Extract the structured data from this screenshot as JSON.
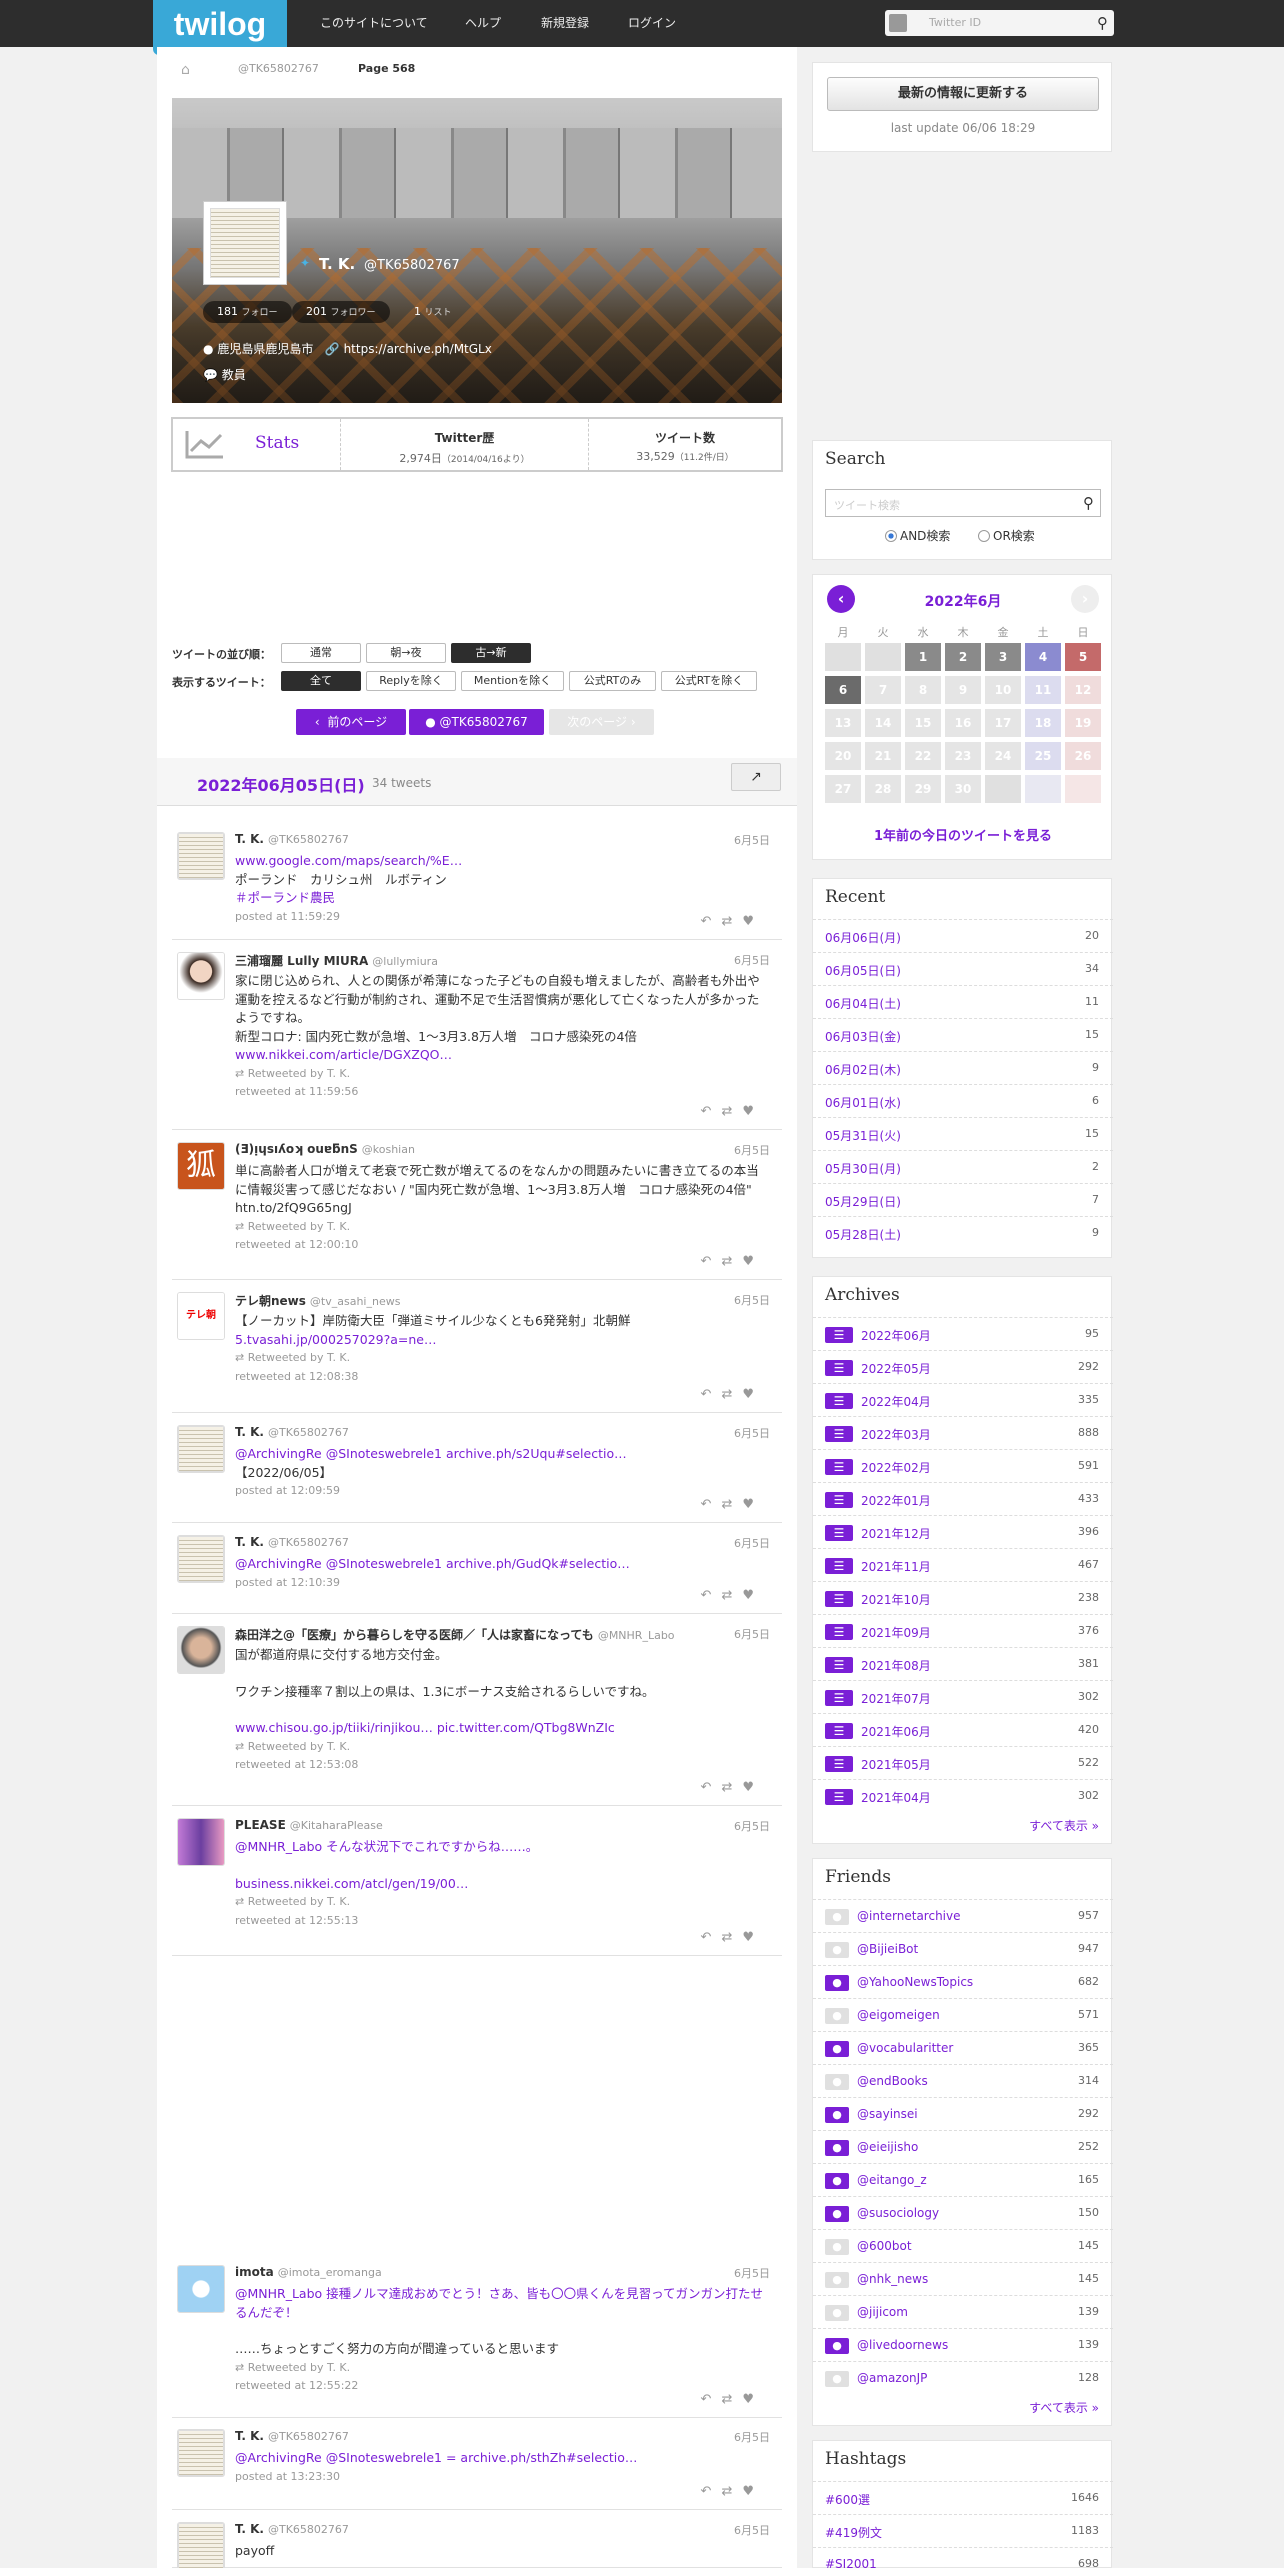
{
  "header": {
    "logo": "twilog",
    "nav": [
      "このサイトについて",
      "ヘルプ",
      "新規登録",
      "ログイン"
    ],
    "search_placeholder": "Twitter ID"
  },
  "breadcrumb": {
    "user": "@TK65802767",
    "page": "Page 568"
  },
  "profile": {
    "name": "T. K.",
    "handle": "@TK65802767",
    "follow_count": "181",
    "follow_label": "フォロー",
    "follower_count": "201",
    "follower_label": "フォロワー",
    "list_count": "1",
    "list_label": "リスト",
    "location": "鹿児島県鹿児島市",
    "url": "https://archive.ph/MtGLx",
    "job": "教員"
  },
  "stats": {
    "label": "Stats",
    "history_title": "Twitter歴",
    "history_value": "2,974日",
    "history_sub": "（2014/04/16より）",
    "tweets_title": "ツイート数",
    "tweets_value": "33,529",
    "tweets_sub": "（11.2件/日）"
  },
  "options": {
    "order_label": "ツイートの並び順：",
    "order": [
      "通常",
      "朝→夜",
      "古→新"
    ],
    "show_label": "表示するツイート：",
    "show": [
      "全て",
      "Replyを除く",
      "Mentionを除く",
      "公式RTのみ",
      "公式RTを除く"
    ]
  },
  "pager": {
    "prev": "前のページ",
    "user": "@TK65802767",
    "next": "次のページ"
  },
  "day": {
    "title": "2022年06月05日(日)",
    "count": "34 tweets"
  },
  "tweets": [
    {
      "name": "T. K.",
      "handle": "@TK65802767",
      "date": "6月5日",
      "lines": [
        "www.google.com/maps/search/%E…",
        "ポーランド　カリシュ州　ルボティン",
        "＃ポーランド農民"
      ],
      "rt": "",
      "footer": "posted at 11:59:29"
    },
    {
      "name": "三浦瑠麗 Lully MIURA",
      "handle": "@lullymiura",
      "date": "6月5日",
      "lines": [
        "家に閉じ込められ、人との関係が希薄になった子どもの自殺も増えましたが、高齢者も外出や運動を控えるなど行動が制約され、運動不足で生活習慣病が悪化して亡くなった人が多かったようですね。",
        "新型コロナ: 国内死亡数が急増、1～3月3.8万人増　コロナ感染死の4倍",
        "www.nikkei.com/article/DGXZQO…"
      ],
      "rt": "Retweeted by T. K.",
      "footer": "retweeted at 11:59:56"
    },
    {
      "name": "(Ǝ)ᴉɥsıʎoʞ ouɐƃnS",
      "handle": "@koshian",
      "date": "6月5日",
      "lines": [
        "単に高齢者人口が増えて老衰で死亡数が増えてるのをなんかの問題みたいに書き立てるの本当に情報災害って感じだなおい / \"国内死亡数が急増、1～3月3.8万人増　コロナ感染死の4倍\" htn.to/2fQ9G65ngJ"
      ],
      "rt": "Retweeted by T. K.",
      "footer": "retweeted at 12:00:10"
    },
    {
      "name": "テレ朝news",
      "handle": "@tv_asahi_news",
      "date": "6月5日",
      "lines": [
        "【ノーカット】岸防衛大臣「弾道ミサイル少なくとも6発発射」北朝鮮",
        "5.tvasahi.jp/000257029?a=ne…"
      ],
      "rt": "Retweeted by T. K.",
      "footer": "retweeted at 12:08:38"
    },
    {
      "name": "T. K.",
      "handle": "@TK65802767",
      "date": "6月5日",
      "lines": [
        "@ArchivingRe @SInoteswebrele1 archive.ph/s2Uqu#selectio…",
        "【2022/06/05】"
      ],
      "rt": "",
      "footer": "posted at 12:09:59"
    },
    {
      "name": "T. K.",
      "handle": "@TK65802767",
      "date": "6月5日",
      "lines": [
        "@ArchivingRe @SInoteswebrele1 archive.ph/GudQk#selectio…"
      ],
      "rt": "",
      "footer": "posted at 12:10:39"
    },
    {
      "name": "森田洋之@「医療」から暮らしを守る医師／「人は家畜になっても",
      "handle": "@MNHR_Labo",
      "date": "6月5日",
      "lines": [
        "国が都道府県に交付する地方交付金。",
        "",
        "ワクチン接種率７割以上の県は、1.3にボーナス支給されるらしいですね。",
        "",
        "www.chisou.go.jp/tiiki/rinjikou… pic.twitter.com/QTbg8WnZIc"
      ],
      "rt": "Retweeted by T. K.",
      "footer": "retweeted at 12:53:08"
    },
    {
      "name": "PLEASE",
      "handle": "@KitaharaPlease",
      "date": "6月5日",
      "lines": [
        "@MNHR_Labo そんな状況下でこれですからね……。",
        "",
        "business.nikkei.com/atcl/gen/19/00…"
      ],
      "rt": "Retweeted by T. K.",
      "footer": "retweeted at 12:55:13"
    },
    {
      "name": "imota",
      "handle": "@imota_eromanga",
      "date": "6月5日",
      "lines": [
        "@MNHR_Labo 接種ノルマ達成おめでとう！さあ、皆も〇〇県くんを見習ってガンガン打たせるんだぞ！",
        "",
        "……ちょっとすごく努力の方向が間違っていると思います"
      ],
      "rt": "Retweeted by T. K.",
      "footer": "retweeted at 12:55:22"
    },
    {
      "name": "T. K.",
      "handle": "@TK65802767",
      "date": "6月5日",
      "lines": [
        "@ArchivingRe @SInoteswebrele1 = archive.ph/sthZh#selectio…"
      ],
      "rt": "",
      "footer": "posted at 13:23:30"
    },
    {
      "name": "T. K.",
      "handle": "@TK65802767",
      "date": "6月5日",
      "lines": [
        "payoff"
      ],
      "rt": "",
      "footer": ""
    }
  ],
  "sidebar": {
    "update_button": "最新の情報に更新する",
    "last_update": "last update 06/06 18:29",
    "search_title": "Search",
    "search_placeholder": "ツイート検索",
    "and_label": "AND検索",
    "or_label": "OR検索",
    "calendar_title": "2022年6月",
    "dow": [
      "月",
      "火",
      "水",
      "木",
      "金",
      "土",
      "日"
    ],
    "calendar_days": [
      "",
      "",
      "1",
      "2",
      "3",
      "4",
      "5",
      "6",
      "7",
      "8",
      "9",
      "10",
      "11",
      "12",
      "13",
      "14",
      "15",
      "16",
      "17",
      "18",
      "19",
      "20",
      "21",
      "22",
      "23",
      "24",
      "25",
      "26",
      "27",
      "28",
      "29",
      "30",
      "",
      "",
      ""
    ],
    "last_year_link": "1年前の今日のツイートを見る",
    "recent_title": "Recent",
    "recent": [
      {
        "label": "06月06日(月)",
        "count": "20"
      },
      {
        "label": "06月05日(日)",
        "count": "34"
      },
      {
        "label": "06月04日(土)",
        "count": "11"
      },
      {
        "label": "06月03日(金)",
        "count": "15"
      },
      {
        "label": "06月02日(木)",
        "count": "9"
      },
      {
        "label": "06月01日(水)",
        "count": "6"
      },
      {
        "label": "05月31日(火)",
        "count": "15"
      },
      {
        "label": "05月30日(月)",
        "count": "2"
      },
      {
        "label": "05月29日(日)",
        "count": "7"
      },
      {
        "label": "05月28日(土)",
        "count": "9"
      }
    ],
    "archives_title": "Archives",
    "archives": [
      {
        "label": "2022年06月",
        "count": "95"
      },
      {
        "label": "2022年05月",
        "count": "292"
      },
      {
        "label": "2022年04月",
        "count": "335"
      },
      {
        "label": "2022年03月",
        "count": "888"
      },
      {
        "label": "2022年02月",
        "count": "591"
      },
      {
        "label": "2022年01月",
        "count": "433"
      },
      {
        "label": "2021年12月",
        "count": "396"
      },
      {
        "label": "2021年11月",
        "count": "467"
      },
      {
        "label": "2021年10月",
        "count": "238"
      },
      {
        "label": "2021年09月",
        "count": "376"
      },
      {
        "label": "2021年08月",
        "count": "381"
      },
      {
        "label": "2021年07月",
        "count": "302"
      },
      {
        "label": "2021年06月",
        "count": "420"
      },
      {
        "label": "2021年05月",
        "count": "522"
      },
      {
        "label": "2021年04月",
        "count": "302"
      }
    ],
    "show_all": "すべて表示 »",
    "friends_title": "Friends",
    "friends": [
      {
        "label": "@internetarchive",
        "count": "957"
      },
      {
        "label": "@BijieiBot",
        "count": "947"
      },
      {
        "label": "@YahooNewsTopics",
        "count": "682"
      },
      {
        "label": "@eigomeigen",
        "count": "571"
      },
      {
        "label": "@vocabularitter",
        "count": "365"
      },
      {
        "label": "@endBooks",
        "count": "314"
      },
      {
        "label": "@sayinsei",
        "count": "292"
      },
      {
        "label": "@eieijisho",
        "count": "252"
      },
      {
        "label": "@eitango_z",
        "count": "165"
      },
      {
        "label": "@susociology",
        "count": "150"
      },
      {
        "label": "@600bot",
        "count": "145"
      },
      {
        "label": "@nhk_news",
        "count": "145"
      },
      {
        "label": "@jijicom",
        "count": "139"
      },
      {
        "label": "@livedoornews",
        "count": "139"
      },
      {
        "label": "@amazonJP",
        "count": "128"
      }
    ],
    "hashtags_title": "Hashtags",
    "hashtags": [
      {
        "label": "#600選",
        "count": "1646"
      },
      {
        "label": "#419例文",
        "count": "1183"
      },
      {
        "label": "#SI2001",
        "count": "698"
      }
    ],
    "colors": {
      "accent": "#7a1fd6",
      "topbar": "#2d2d2d",
      "logo": "#39a8d7"
    }
  }
}
